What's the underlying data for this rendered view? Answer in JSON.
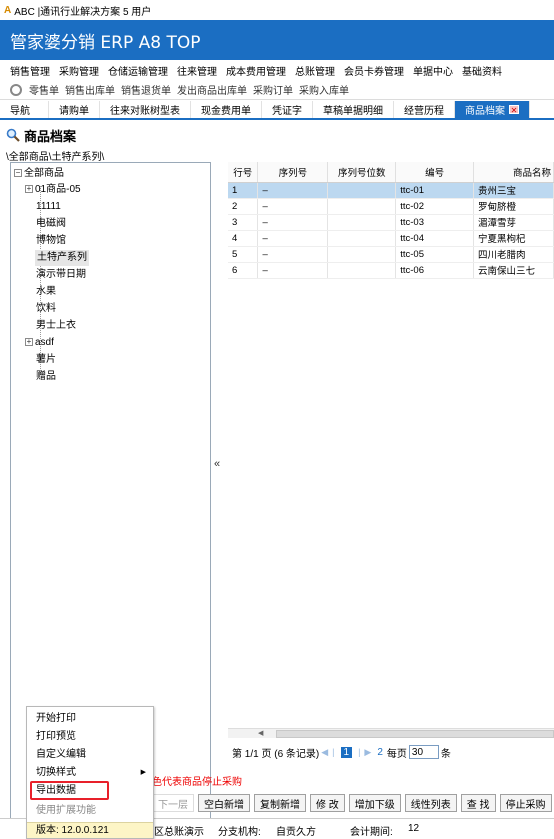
{
  "window": {
    "logo": "A",
    "title": "ABC  |通讯行业解决方案 5 用户"
  },
  "brand": "管家婆分销 ERP A8 TOP",
  "main_menu": [
    "销售管理",
    "采购管理",
    "仓储运输管理",
    "往来管理",
    "成本费用管理",
    "总账管理",
    "会员卡券管理",
    "单据中心",
    "基础资料"
  ],
  "quick_bar": [
    "零售单",
    "销售出库单",
    "销售退货单",
    "发出商品出库单",
    "采购订单",
    "采购入库单"
  ],
  "tabs": [
    "导航",
    "请购单",
    "往来对账树型表",
    "现金费用单",
    "凭证字",
    "草稿单据明细",
    "经营历程",
    "商品档案"
  ],
  "page_title": "商品档案",
  "breadcrumb": "\\全部商品\\土特产系列\\",
  "tree": {
    "root": "全部商品",
    "items": [
      "01商品-05",
      "11111",
      "电磁阀",
      "博物馆",
      "土特产系列",
      "演示带日期",
      "水果",
      "饮料",
      "男士上衣",
      "asdf",
      "薯片",
      "赠品"
    ]
  },
  "grid": {
    "columns": [
      "行号",
      "序列号",
      "序列号位数",
      "编号",
      "商品名称"
    ],
    "rows": [
      {
        "no": "1",
        "serial": "–",
        "digits": "",
        "code": "ttc-01",
        "name": "贵州三宝"
      },
      {
        "no": "2",
        "serial": "–",
        "digits": "",
        "code": "ttc-02",
        "name": "罗甸脐橙"
      },
      {
        "no": "3",
        "serial": "–",
        "digits": "",
        "code": "ttc-03",
        "name": "湄潭雪芽"
      },
      {
        "no": "4",
        "serial": "–",
        "digits": "",
        "code": "ttc-04",
        "name": "宁夏黑枸杞"
      },
      {
        "no": "5",
        "serial": "–",
        "digits": "",
        "code": "ttc-05",
        "name": "四川老腊肉"
      },
      {
        "no": "6",
        "serial": "–",
        "digits": "",
        "code": "ttc-06",
        "name": "云南保山三七"
      }
    ]
  },
  "pager": {
    "summary": "第 1/1 页 (6 条记录)",
    "current_page": "1",
    "next_page": "2",
    "per_page_label": "每页",
    "per_page": "30",
    "unit": "条"
  },
  "note": "色代表商品停止采购",
  "buttons": [
    "下一层",
    "空白新增",
    "复制新增",
    "修 改",
    "增加下级",
    "线性列表",
    "查 找",
    "停止采购"
  ],
  "status": {
    "region": "区总账演示",
    "branch_label": "分支机构:",
    "branch_value": "自贡久方",
    "period_label": "会计期间:",
    "period_value": "12"
  },
  "context_menu": {
    "items": [
      "开始打印",
      "打印预览",
      "自定义编辑",
      "切换样式",
      "导出数据",
      "使用扩展功能"
    ],
    "version": "版本: 12.0.0.121"
  },
  "splitter_glyph": "«"
}
